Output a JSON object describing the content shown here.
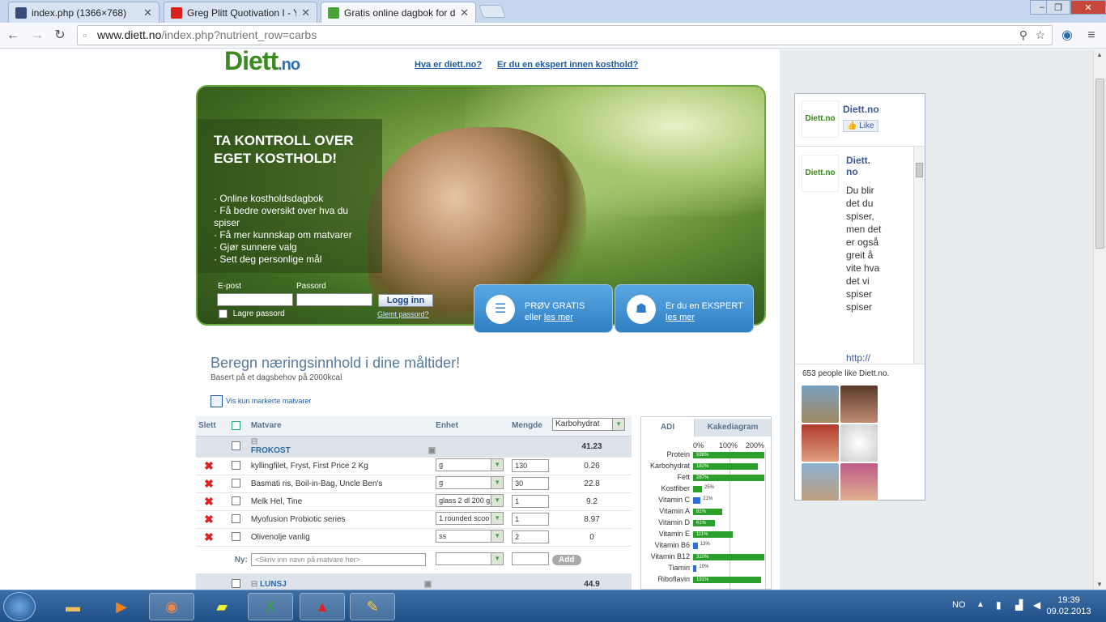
{
  "browser": {
    "tabs": [
      {
        "label": "index.php (1366×768)",
        "fav_color": "#3a4d7a",
        "icon": "document-icon"
      },
      {
        "label": "Greg Plitt Quotivation I - Y",
        "fav_color": "#d92020",
        "icon": "youtube-icon"
      },
      {
        "label": "Gratis online dagbok for d",
        "fav_color": "#49a23a",
        "icon": "heart-icon"
      }
    ],
    "url_host": "www.diett.no",
    "url_path": "/index.php?nutrient_row=carbs",
    "window_controls": [
      "–",
      "❐",
      "✕"
    ]
  },
  "page": {
    "logo_main": "Diett",
    "logo_tld": ".no",
    "top_links": [
      "Hva er diett.no?",
      "Er du en ekspert innen kosthold?"
    ],
    "hero": {
      "title": "TA KONTROLL OVER EGET KOSTHOLD!",
      "bullets": [
        "· Online kostholdsdagbok",
        "· Få bedre oversikt over hva du spiser",
        "· Få mer kunnskap om matvarer",
        "· Gjør sunnere valg",
        "· Sett deg personlige mål"
      ],
      "email_label": "E-post",
      "password_label": "Passord",
      "login_button": "Logg inn",
      "remember_label": "Lagre passord",
      "forgot_link": "Glemt passord?"
    },
    "cta": [
      {
        "line1": "PRØV GRATIS",
        "line2": "eller ",
        "link": "les mer"
      },
      {
        "line1": "Er du en EKSPERT",
        "line2": "",
        "link": "les mer"
      }
    ],
    "section_title": "Beregn næringsinnhold i dine måltider!",
    "section_sub": "Basert på et dagsbehov på 2000kcal",
    "vis_link": "Vis kun markerte matvarer",
    "table": {
      "headers": {
        "delete": "Slett",
        "food": "Matvare",
        "unit": "Enhet",
        "amount": "Mengde",
        "nutrient": "Karbohydrat"
      },
      "meals": [
        {
          "name": "FROKOST",
          "total": "41.23",
          "rows": [
            {
              "food": "kyllingfilet, Fryst, First Price 2 Kg",
              "unit": "g",
              "amount": "130",
              "value": "0.26"
            },
            {
              "food": "Basmati ris, Boil-in-Bag, Uncle Ben's",
              "unit": "g",
              "amount": "30",
              "value": "22.8"
            },
            {
              "food": "Melk Hel, Tine",
              "unit": "glass 2 dl 200 g",
              "amount": "1",
              "value": "9.2"
            },
            {
              "food": "Myofusion Probiotic series",
              "unit": "1 rounded scoo",
              "amount": "1",
              "value": "8.97"
            },
            {
              "food": "Olivenolje vanlig",
              "unit": "ss",
              "amount": "2",
              "value": "0"
            }
          ]
        },
        {
          "name": "LUNSJ",
          "total": "44.9",
          "rows": []
        }
      ],
      "new_label": "Ny:",
      "new_placeholder": "<Skriv inn navn på matvare her>",
      "add_button": "Add"
    },
    "adi": {
      "tabs": [
        "ADI",
        "Kakediagram"
      ],
      "scale": [
        "0%",
        "100%",
        "200%"
      ],
      "rows": [
        {
          "label": "Protein",
          "pct": 598,
          "text": "598%",
          "color": "#2aa02a"
        },
        {
          "label": "Karbohydrat",
          "pct": 182,
          "text": "182%",
          "color": "#2aa02a"
        },
        {
          "label": "Fett",
          "pct": 287,
          "text": "287%",
          "color": "#2aa02a"
        },
        {
          "label": "Kostfiber",
          "pct": 25,
          "text": "25%",
          "color": "#2aa02a"
        },
        {
          "label": "Vitamin C",
          "pct": 21,
          "text": "21%",
          "color": "#2a6ee0"
        },
        {
          "label": "Vitamin A",
          "pct": 81,
          "text": "81%",
          "color": "#2aa02a"
        },
        {
          "label": "Vitamin D",
          "pct": 61,
          "text": "61%",
          "color": "#2aa02a"
        },
        {
          "label": "Vitamin E",
          "pct": 111,
          "text": "111%",
          "color": "#2aa02a"
        },
        {
          "label": "Vitamin B6",
          "pct": 13,
          "text": "13%",
          "color": "#2a6ee0"
        },
        {
          "label": "Vitamin B12",
          "pct": 310,
          "text": "310%",
          "color": "#2aa02a"
        },
        {
          "label": "Tiamin",
          "pct": 10,
          "text": "10%",
          "color": "#2a6ee0"
        },
        {
          "label": "Riboflavin",
          "pct": 191,
          "text": "191%",
          "color": "#2aa02a"
        }
      ]
    },
    "facebook": {
      "page_name": "Diett.no",
      "like": "Like",
      "post_name": "Diett.\nno",
      "post_text": "Du blir det du spiser, men det er også greit å vite hva det vi spiser spiser",
      "post_link": "http://",
      "likes_text": "653 people like Diett.no.",
      "logo_text": "Diett.no"
    }
  },
  "taskbar": {
    "lang": "NO",
    "time": "19:39",
    "date": "09.02.2013"
  }
}
